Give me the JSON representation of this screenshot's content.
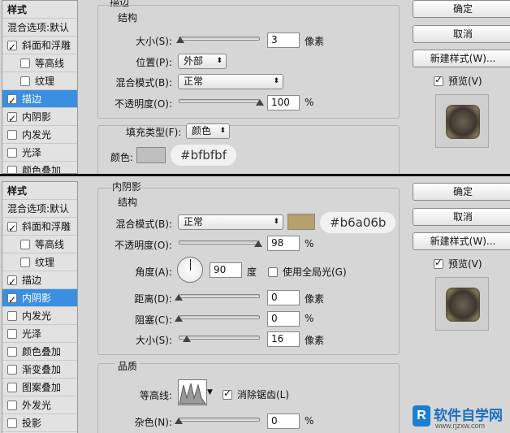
{
  "top": {
    "styles": {
      "header": "样式",
      "blend": "混合选项:默认",
      "items": [
        {
          "label": "斜面和浮雕",
          "checked": true,
          "indent": false,
          "selected": false
        },
        {
          "label": "等高线",
          "checked": false,
          "indent": true,
          "selected": false
        },
        {
          "label": "纹理",
          "checked": false,
          "indent": true,
          "selected": false
        },
        {
          "label": "描边",
          "checked": true,
          "indent": false,
          "selected": true
        },
        {
          "label": "内阴影",
          "checked": true,
          "indent": false,
          "selected": false
        },
        {
          "label": "内发光",
          "checked": false,
          "indent": false,
          "selected": false
        },
        {
          "label": "光泽",
          "checked": false,
          "indent": false,
          "selected": false
        },
        {
          "label": "颜色叠加",
          "checked": false,
          "indent": false,
          "selected": false
        }
      ]
    },
    "section_title": "描边",
    "structure_title": "结构",
    "size_label": "大小(S):",
    "size_value": "3",
    "size_unit": "像素",
    "size_slider": 0.02,
    "position_label": "位置(P):",
    "position_value": "外部",
    "blend_label": "混合模式(B):",
    "blend_value": "正常",
    "opacity_label": "不透明度(O):",
    "opacity_value": "100",
    "opacity_unit": "%",
    "opacity_slider": 1.0,
    "fill_type_label": "填充类型(F):",
    "fill_type_value": "颜色",
    "color_label": "颜色:",
    "color_hex": "#bfbfbf",
    "color_swatch": "#bfbfbf",
    "buttons": {
      "ok": "确定",
      "cancel": "取消",
      "new_style": "新建样式(W)..."
    },
    "preview_label": "预览(V)",
    "preview_checked": true
  },
  "bottom": {
    "styles": {
      "header": "样式",
      "blend": "混合选项:默认",
      "items": [
        {
          "label": "斜面和浮雕",
          "checked": true,
          "indent": false,
          "selected": false
        },
        {
          "label": "等高线",
          "checked": false,
          "indent": true,
          "selected": false
        },
        {
          "label": "纹理",
          "checked": false,
          "indent": true,
          "selected": false
        },
        {
          "label": "描边",
          "checked": true,
          "indent": false,
          "selected": false
        },
        {
          "label": "内阴影",
          "checked": true,
          "indent": false,
          "selected": true
        },
        {
          "label": "内发光",
          "checked": false,
          "indent": false,
          "selected": false
        },
        {
          "label": "光泽",
          "checked": false,
          "indent": false,
          "selected": false
        },
        {
          "label": "颜色叠加",
          "checked": false,
          "indent": false,
          "selected": false
        },
        {
          "label": "渐变叠加",
          "checked": false,
          "indent": false,
          "selected": false
        },
        {
          "label": "图案叠加",
          "checked": false,
          "indent": false,
          "selected": false
        },
        {
          "label": "外发光",
          "checked": false,
          "indent": false,
          "selected": false
        },
        {
          "label": "投影",
          "checked": false,
          "indent": false,
          "selected": false
        }
      ]
    },
    "section_title": "内阴影",
    "structure_title": "结构",
    "blend_label": "混合模式(B):",
    "blend_value": "正常",
    "color_hex": "#b6a06b",
    "color_swatch": "#b6a06b",
    "opacity_label": "不透明度(O):",
    "opacity_value": "98",
    "opacity_unit": "%",
    "opacity_slider": 0.98,
    "angle_label": "角度(A):",
    "angle_value": "90",
    "angle_unit": "度",
    "global_light_label": "使用全局光(G)",
    "global_light_checked": false,
    "distance_label": "距离(D):",
    "distance_value": "0",
    "distance_unit": "像素",
    "distance_slider": 0.0,
    "choke_label": "阻塞(C):",
    "choke_value": "0",
    "choke_unit": "%",
    "choke_slider": 0.0,
    "size_label": "大小(S):",
    "size_value": "16",
    "size_unit": "像素",
    "size_slider": 0.1,
    "quality_title": "品质",
    "contour_label": "等高线:",
    "antialias_label": "消除锯齿(L)",
    "antialias_checked": true,
    "noise_label": "杂色(N):",
    "noise_value": "0",
    "noise_unit": "%",
    "noise_slider": 0.0,
    "buttons": {
      "ok": "确定",
      "cancel": "取消",
      "new_style": "新建样式(W)..."
    },
    "preview_label": "预览(V)",
    "preview_checked": true
  },
  "watermark": {
    "brand": "软件自学网",
    "url": "www.rjzxw.com"
  }
}
